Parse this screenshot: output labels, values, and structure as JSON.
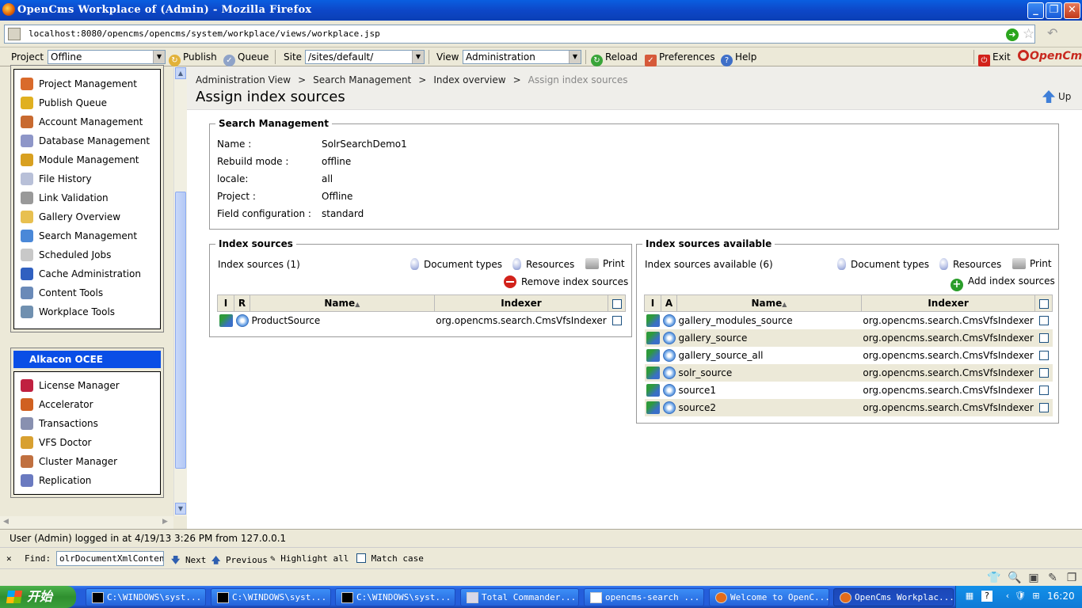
{
  "window": {
    "title": "OpenCms Workplace of (Admin) - Mozilla Firefox",
    "controls": [
      "_",
      "❐",
      "✕"
    ]
  },
  "address_bar": {
    "url": "localhost:8080/opencms/opencms/system/workplace/views/workplace.jsp"
  },
  "toolbar": {
    "project_label": "Project",
    "project_value": "Offline",
    "publish_label": "Publish",
    "queue_label": "Queue",
    "site_label": "Site",
    "site_value": "/sites/default/",
    "view_label": "View",
    "view_value": "Administration",
    "reload_label": "Reload",
    "preferences_label": "Preferences",
    "help_label": "Help",
    "exit_label": "Exit",
    "logo_text": "OpenCms"
  },
  "left_nav": {
    "admin_items": [
      {
        "label": "Project Management",
        "icon": "project-management-icon",
        "color": "#d96a2b"
      },
      {
        "label": "Publish Queue",
        "icon": "publish-queue-icon",
        "color": "#e0b020"
      },
      {
        "label": "Account Management",
        "icon": "account-management-icon",
        "color": "#c86a30"
      },
      {
        "label": "Database Management",
        "icon": "database-management-icon",
        "color": "#8e96c8"
      },
      {
        "label": "Module Management",
        "icon": "module-management-icon",
        "color": "#d8a020"
      },
      {
        "label": "File History",
        "icon": "file-history-icon",
        "color": "#b8c0d8"
      },
      {
        "label": "Link Validation",
        "icon": "link-validation-icon",
        "color": "#999999"
      },
      {
        "label": "Gallery Overview",
        "icon": "gallery-overview-icon",
        "color": "#e8c050"
      },
      {
        "label": "Search Management",
        "icon": "search-management-icon",
        "color": "#4a88d8"
      },
      {
        "label": "Scheduled Jobs",
        "icon": "scheduled-jobs-icon",
        "color": "#c8c8c8"
      },
      {
        "label": "Cache Administration",
        "icon": "cache-administration-icon",
        "color": "#3060c0"
      },
      {
        "label": "Content Tools",
        "icon": "content-tools-icon",
        "color": "#6a8ab8"
      },
      {
        "label": "Workplace Tools",
        "icon": "workplace-tools-icon",
        "color": "#7090b0"
      }
    ],
    "ocee_title": "Alkacon OCEE",
    "ocee_items": [
      {
        "label": "License Manager",
        "icon": "license-manager-icon",
        "color": "#c02040"
      },
      {
        "label": "Accelerator",
        "icon": "accelerator-icon",
        "color": "#d06020"
      },
      {
        "label": "Transactions",
        "icon": "transactions-icon",
        "color": "#8890b0"
      },
      {
        "label": "VFS Doctor",
        "icon": "vfs-doctor-icon",
        "color": "#d8a030"
      },
      {
        "label": "Cluster Manager",
        "icon": "cluster-manager-icon",
        "color": "#c07040"
      },
      {
        "label": "Replication",
        "icon": "replication-icon",
        "color": "#6a7ac0"
      }
    ]
  },
  "breadcrumb": [
    "Administration View",
    "Search Management",
    "Index overview",
    "Assign index sources"
  ],
  "page_title": "Assign index sources",
  "up_label": "Up",
  "search_management": {
    "legend": "Search Management",
    "fields": [
      {
        "label": "Name :",
        "value": "SolrSearchDemo1"
      },
      {
        "label": "Rebuild mode :",
        "value": "offline"
      },
      {
        "label": "locale:",
        "value": "all"
      },
      {
        "label": "Project :",
        "value": "Offline"
      },
      {
        "label": "Field configuration :",
        "value": "standard"
      }
    ]
  },
  "index_sources": {
    "legend": "Index sources",
    "count_label": "Index sources (1)",
    "doc_types_label": "Document types",
    "resources_label": "Resources",
    "print_label": "Print",
    "action_label": "Remove index sources",
    "col_i": "I",
    "col_r": "R",
    "col_name": "Name",
    "col_indexer": "Indexer",
    "rows": [
      {
        "name": "ProductSource",
        "indexer": "org.opencms.search.CmsVfsIndexer"
      }
    ]
  },
  "available": {
    "legend": "Index sources available",
    "count_label": "Index sources available (6)",
    "doc_types_label": "Document types",
    "resources_label": "Resources",
    "print_label": "Print",
    "action_label": "Add index sources",
    "col_i": "I",
    "col_a": "A",
    "col_name": "Name",
    "col_indexer": "Indexer",
    "rows": [
      {
        "name": "gallery_modules_source",
        "indexer": "org.opencms.search.CmsVfsIndexer"
      },
      {
        "name": "gallery_source",
        "indexer": "org.opencms.search.CmsVfsIndexer"
      },
      {
        "name": "gallery_source_all",
        "indexer": "org.opencms.search.CmsVfsIndexer"
      },
      {
        "name": "solr_source",
        "indexer": "org.opencms.search.CmsVfsIndexer"
      },
      {
        "name": "source1",
        "indexer": "org.opencms.search.CmsVfsIndexer"
      },
      {
        "name": "source2",
        "indexer": "org.opencms.search.CmsVfsIndexer"
      }
    ]
  },
  "status_line": "User (Admin) logged in at 4/19/13 3:26 PM from 127.0.0.1",
  "find_bar": {
    "close": "✕",
    "label": "Find:",
    "value": "olrDocumentXmlContent",
    "next": "Next",
    "previous": "Previous",
    "highlight": "Highlight all",
    "match_case": "Match case"
  },
  "taskbar": {
    "start_label": "开始",
    "tasks": [
      {
        "label": "C:\\WINDOWS\\syst..."
      },
      {
        "label": "C:\\WINDOWS\\syst..."
      },
      {
        "label": "C:\\WINDOWS\\syst..."
      },
      {
        "label": "Total Commander..."
      },
      {
        "label": "opencms-search ..."
      },
      {
        "label": "Welcome to OpenC..."
      },
      {
        "label": "OpenCms Workplac..."
      }
    ],
    "clock": "16:20"
  }
}
